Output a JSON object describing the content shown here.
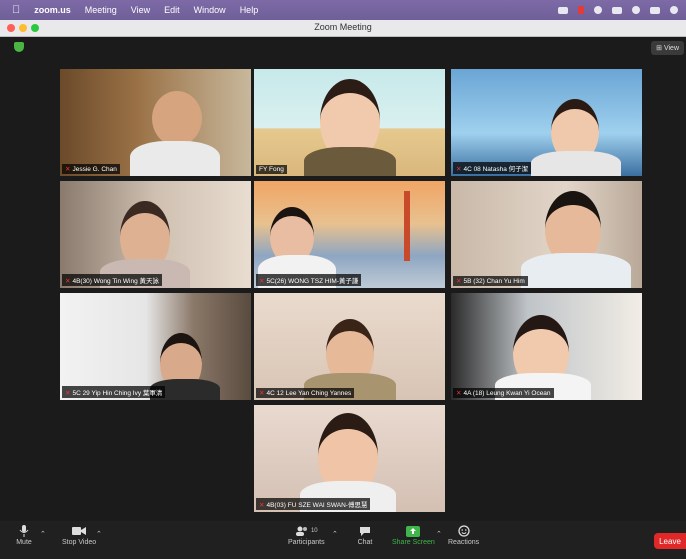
{
  "menubar": {
    "app": "zoom.us",
    "items": [
      "Meeting",
      "View",
      "Edit",
      "Window",
      "Help"
    ]
  },
  "window": {
    "title": "Zoom Meeting"
  },
  "view_button": "⊞ View",
  "participants": [
    {
      "label": "Jessie G. Chan"
    },
    {
      "label": "FY Fong"
    },
    {
      "label": "4C 08 Natasha 何子潔"
    },
    {
      "label": "4B(30) Wong Tin Wing 黃天詠"
    },
    {
      "label": "5C(26) WONG TSZ HIM-黃子謙"
    },
    {
      "label": "5B (32) Chan Yu Him"
    },
    {
      "label": "5C 29 Yip Hin Ching Ivy 葉軍清"
    },
    {
      "label": "4C 12 Lee Yan Ching Yannes"
    },
    {
      "label": "4A (18) Leung Kwan Yi Ocean"
    },
    {
      "label": "4B(03) FU SZE WAI SWAN-傅思慧"
    }
  ],
  "toolbar": {
    "mute": "Mute",
    "stop_video": "Stop Video",
    "participants": "Participants",
    "participant_count": "10",
    "chat": "Chat",
    "share_screen": "Share Screen",
    "reactions": "Reactions",
    "leave": "Leave"
  },
  "colors": {
    "menubar": "#7d6aa7",
    "active_speaker": "#c8d94a",
    "share_green": "#3fb54a",
    "leave_red": "#e02828"
  }
}
